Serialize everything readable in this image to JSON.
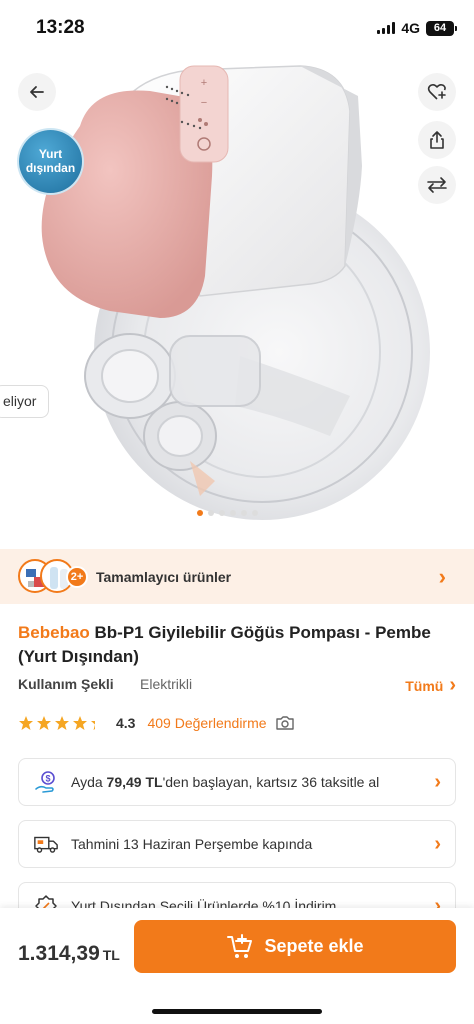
{
  "status": {
    "time": "13:28",
    "network": "4G",
    "battery": "64"
  },
  "hero": {
    "origin_badge": [
      "Yurt",
      "dışından"
    ],
    "side_pill": "eliyor",
    "image_count": 6,
    "active_image_index": 0
  },
  "complementary": {
    "count": "2+",
    "label": "Tamamlayıcı ürünler"
  },
  "product": {
    "brand": "Bebebao",
    "name": " Bb-P1 Giyilebilir Göğüs Pompası - Pembe (Yurt Dışından)",
    "attribute_key": "Kullanım Şekli",
    "attribute_value": "Elektrikli",
    "attribute_all": "Tümü",
    "rating": "4.3",
    "rating_stars": 4.3,
    "review_count": "409 Değerlendirme"
  },
  "cards": {
    "installment_pre": "Ayda ",
    "installment_amount": "79,49 TL",
    "installment_post": "'den başlayan, kartsız 36 taksitle al",
    "delivery": "Tahmini 13 Haziran Perşembe kapında",
    "discount": "Yurt Dışından Seçili Ürünlerde %10 İndirim"
  },
  "bottom": {
    "price": "1.314,39",
    "currency": "TL",
    "cta": "Sepete ekle"
  },
  "icons": {
    "back": "arrow-left-icon",
    "favorite": "heart-plus-icon",
    "share": "share-icon",
    "compare": "compare-arrows-icon",
    "camera": "camera-icon",
    "installment": "coin-hand-icon",
    "delivery": "truck-icon",
    "discount": "discount-icon",
    "cart": "cart-plus-icon"
  },
  "colors": {
    "accent": "#f27a1a",
    "complementary_bg": "#fdf0e6",
    "star": "#f5a623",
    "badge": "#1e6f9e"
  }
}
